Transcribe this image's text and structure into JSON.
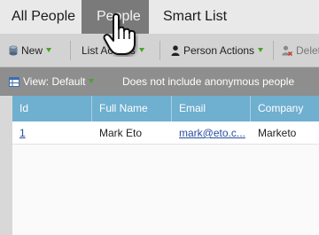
{
  "tabs": [
    {
      "label": "All People"
    },
    {
      "label": "People"
    },
    {
      "label": "Smart List"
    }
  ],
  "toolbar": {
    "new_label": "New",
    "list_actions_label": "List Actions",
    "person_actions_label": "Person Actions",
    "delete_label": "Delete"
  },
  "viewbar": {
    "view_label": "View: Default",
    "note": "Does not include anonymous people"
  },
  "grid": {
    "columns": [
      "Id",
      "Full Name",
      "Email",
      "Company"
    ],
    "rows": [
      {
        "id": "1",
        "full_name": "Mark Eto",
        "email": "mark@eto.c...",
        "company": "Marketo"
      }
    ]
  },
  "colors": {
    "active_tab": "#7a7a7a",
    "header_blue": "#6fafcf",
    "caret_green": "#4aa32a",
    "link_blue": "#2a4e9e"
  }
}
